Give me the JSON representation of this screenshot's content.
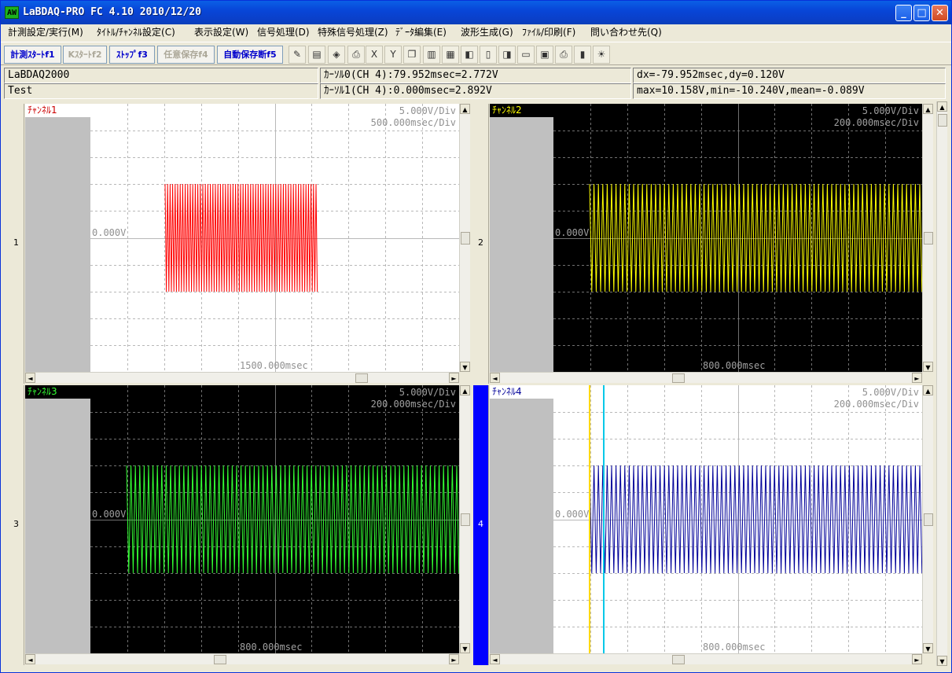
{
  "window": {
    "icon_text": "AW",
    "title": "LaBDAQ-PRO FC  4.10 2010/12/20",
    "min_glyph": "_",
    "max_glyph": "□",
    "close_glyph": "✕"
  },
  "menu": [
    "計測設定/実行(M)",
    "ﾀｲﾄﾙ/ﾁｬﾝﾈﾙ設定(C)",
    "表示設定(W)",
    "信号処理(D)",
    "特殊信号処理(Z)",
    "ﾃﾞｰﾀ編集(E)",
    "波形生成(G)",
    "ﾌｧｲﾙ/印刷(F)",
    "問い合わせ先(Q)"
  ],
  "toolbar": {
    "start": "計測ｽﾀｰﾄf1",
    "kstart": "Kｽﾀｰﾄf2",
    "stop": "ｽﾄｯﾌﾟf3",
    "save_any": "任意保存f4",
    "auto_save_off": "自動保存断f5",
    "x_label": "X",
    "y_label": "Y"
  },
  "info": {
    "device": "LaBDAQ2000",
    "name": "Test",
    "cursor0": "ｶｰｿﾙ0(CH 4):79.952msec=2.772V",
    "cursor1": "ｶｰｿﾙ1(CH 4):0.000msec=2.892V",
    "delta": "dx=-79.952msec,dy=0.120V",
    "stats": "max=10.158V,min=-10.240V,mean=-0.089V"
  },
  "channels": [
    {
      "index": "1",
      "label": "ﾁｬﾝﾈﾙ1",
      "vdiv": "5.000V/Div",
      "tdiv": "500.000msec/Div",
      "zero": "0.000V",
      "time": "1500.000msec",
      "bg": "#ffffff",
      "grid": "#b8b8b8",
      "wave": "#ff0000",
      "label_color": "#cc0000",
      "label_bg": "#ffffff"
    },
    {
      "index": "2",
      "label": "ﾁｬﾝﾈﾙ2",
      "vdiv": "5.000V/Div",
      "tdiv": "200.000msec/Div",
      "zero": "0.000V",
      "time": "800.000msec",
      "bg": "#000000",
      "grid": "#707070",
      "wave": "#ffff00",
      "label_color": "#ffff00",
      "label_bg": "#000000"
    },
    {
      "index": "3",
      "label": "ﾁｬﾝﾈﾙ3",
      "vdiv": "5.000V/Div",
      "tdiv": "200.000msec/Div",
      "zero": "0.000V",
      "time": "800.000msec",
      "bg": "#000000",
      "grid": "#707070",
      "wave": "#33ff33",
      "label_color": "#33ff33",
      "label_bg": "#000000"
    },
    {
      "index": "4",
      "label": "ﾁｬﾝﾈﾙ4",
      "vdiv": "5.000V/Div",
      "tdiv": "200.000msec/Div",
      "zero": "0.000V",
      "time": "800.000msec",
      "bg": "#ffffff",
      "grid": "#b8b8b8",
      "wave": "#000099",
      "label_color": "#000099",
      "label_bg": "#ffffff"
    }
  ],
  "cursor_colors": {
    "cursor0": "#ffd800",
    "cursor1": "#00c8e8"
  },
  "icons": [
    "pencil-icon",
    "screen-icon",
    "eraser-icon",
    "printer-icon",
    "x-axis-icon",
    "y-axis-icon",
    "copy-icon",
    "book-icon",
    "calc-icon",
    "chart-icon",
    "page-icon",
    "paste-icon",
    "folder-open-icon",
    "floppy-save-icon",
    "print-preview-icon",
    "gauge-icon",
    "lightbulb-icon"
  ]
}
